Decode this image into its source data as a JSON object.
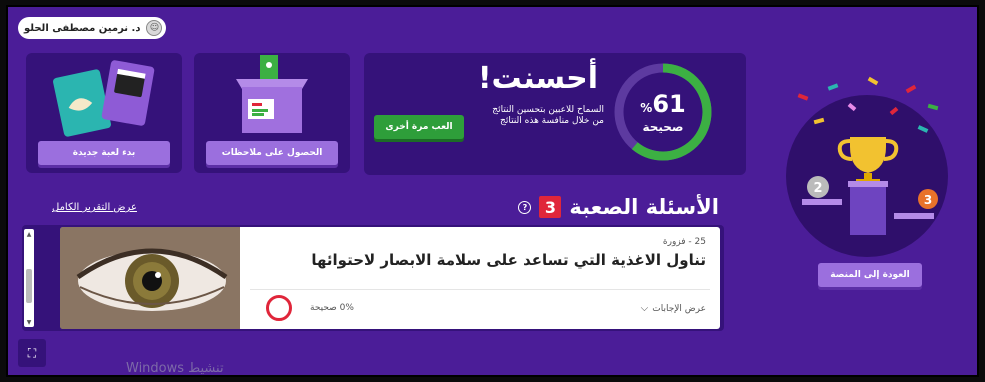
{
  "user": {
    "name": "د. نرمين مصطفى الحلو"
  },
  "cards": {
    "new_game": {
      "label": "بدء لعبة جديدة"
    },
    "feedback": {
      "label": "الحصول على ملاحظات"
    }
  },
  "result": {
    "percent": "61",
    "percent_sign": "%",
    "percent_value": 0.61,
    "correct_label": "صحيحة",
    "headline": "أحسنت!",
    "description": "السماح للاعبين بتحسين النتائج من خلال منافسة هذه النتائج",
    "play_again": "العب مرة أخرى"
  },
  "podium": {
    "back_label": "العودة إلى المنصة"
  },
  "hard_questions": {
    "title": "الأسئلة الصعبة",
    "count": "3",
    "help_icon": "?",
    "full_report": "عرض التقرير الكامل"
  },
  "question": {
    "meta": "25 - فزورة",
    "text": "تناول الاغذية التي تساعد على سلامة الابصار لاحتوائها",
    "show_answers": "عرض الإجابات",
    "correct_rate": "0% صحيحة"
  },
  "watermark": "تنشيط Windows",
  "colors": {
    "background": "#4b1d98",
    "card": "#35127a",
    "accent_button": "#9b6fde",
    "play_again": "#2e9e3a",
    "ring": "#3cb043",
    "hard_badge": "#e0263a"
  }
}
